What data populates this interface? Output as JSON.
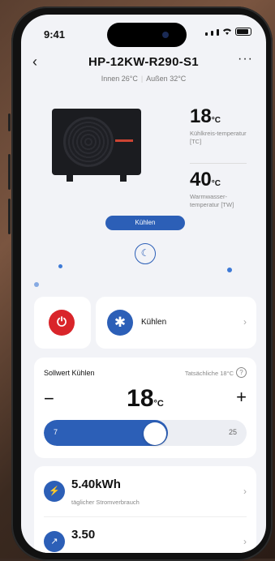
{
  "status": {
    "time": "9:41"
  },
  "header": {
    "title": "HP-12KW-R290-S1",
    "indoor": "Innen 26°C",
    "outdoor": "Außen 32°C",
    "back_icon": "‹",
    "more_icon": "···"
  },
  "temps": {
    "tc_value": "18",
    "tc_unit": "°C",
    "tc_label": "Kühlkreis-temperatur [TC]",
    "tw_value": "40",
    "tw_unit": "°C",
    "tw_label": "Warmwasser-temperatur [TW]"
  },
  "mode_pill": "Kühlen",
  "mode_card": {
    "label": "Kühlen"
  },
  "setpoint": {
    "label": "Sollwert Kühlen",
    "actual": "Tatsächliche 18°C",
    "value": "18",
    "unit": "°C",
    "min": "7",
    "max": "25",
    "level_fraction": 0.61
  },
  "energy": {
    "daily_value": "5.40kWh",
    "daily_label": "täglicher Stromverbrauch",
    "second_value": "3.50"
  },
  "colors": {
    "accent": "#2c5fb7",
    "power": "#d9252a"
  }
}
